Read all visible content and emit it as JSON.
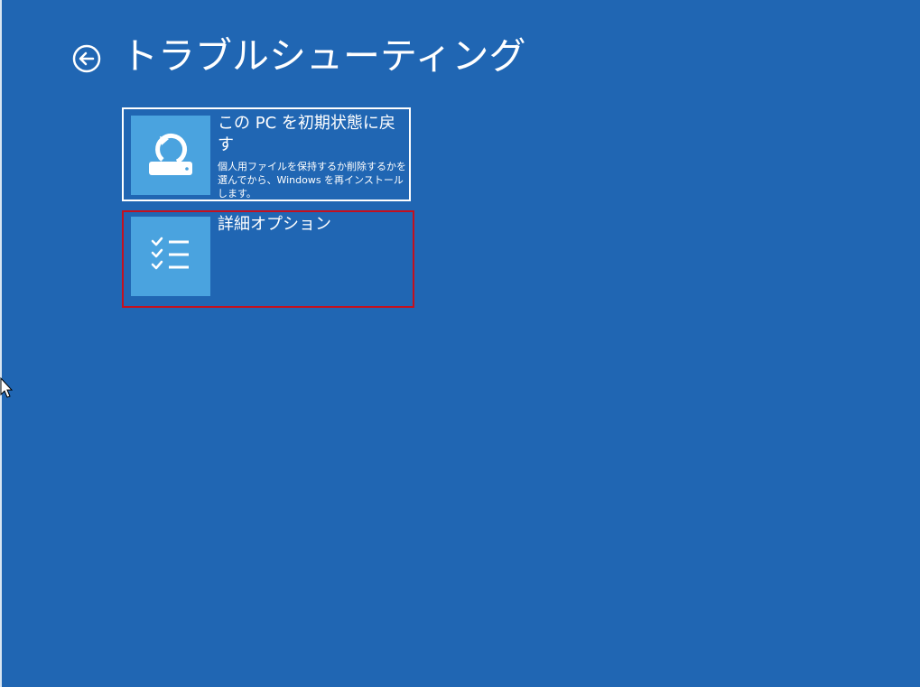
{
  "page": {
    "title": "トラブルシューティング"
  },
  "icons": {
    "back": "back-arrow-circle-icon",
    "reset": "reset-pc-drive-icon",
    "advanced": "checklist-icon",
    "cursor": "mouse-pointer-icon"
  },
  "tiles": [
    {
      "title": "この PC を初期状態に戻す",
      "description": "個人用ファイルを保持するか削除するかを選んでから、Windows を再インストールします。"
    },
    {
      "title": "詳細オプション",
      "description": ""
    }
  ],
  "colors": {
    "background": "#2066b3",
    "tile_icon_bg": "#4aa3df",
    "selection_border": "#c4101e"
  }
}
